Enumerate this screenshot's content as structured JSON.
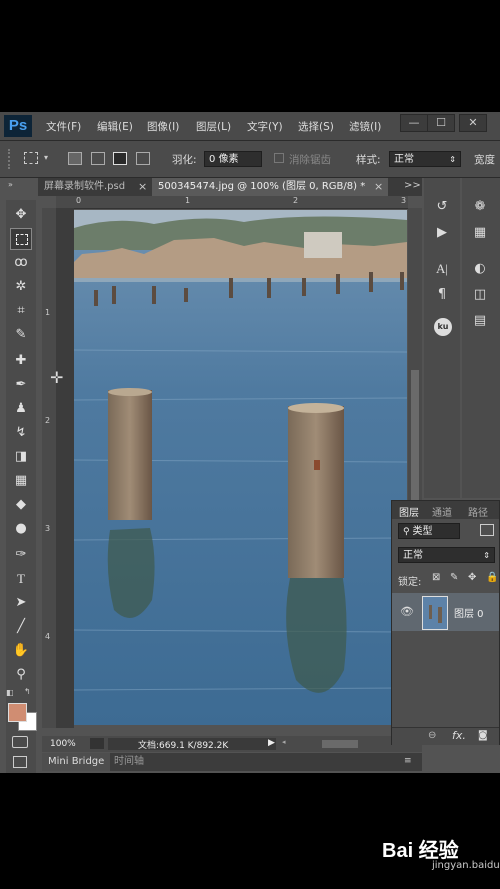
{
  "app": {
    "logo": "Ps",
    "menu": [
      "文件(F)",
      "编辑(E)",
      "图像(I)",
      "图层(L)",
      "文字(Y)",
      "选择(S)",
      "滤镜(I)"
    ],
    "window_buttons": [
      "—",
      "☐",
      "✕"
    ]
  },
  "options": {
    "feather_label": "羽化:",
    "feather_value": "0 像素",
    "antialias_label": "消除锯齿",
    "style_label": "样式:",
    "style_value": "正常",
    "width_label": "宽度"
  },
  "tabs": [
    {
      "label": "屏幕录制软件.psd",
      "close": "×"
    },
    {
      "label": "500345474.jpg @ 100% (图层 0, RGB/8) *",
      "close": "×"
    }
  ],
  "tabs_overflow": ">>",
  "rulers": {
    "top": [
      "0",
      "1",
      "2",
      "3"
    ],
    "left": [
      "1",
      "2",
      "3",
      "4"
    ]
  },
  "status": {
    "zoom": "100%",
    "doc": "文档:669.1 K/892.2K"
  },
  "bottom_tabs": [
    "Mini Bridge",
    "时间轴"
  ],
  "layers_panel": {
    "tabs": [
      "图层",
      "通道",
      "路径"
    ],
    "filter_label": "类型",
    "blend_mode": "正常",
    "lock_label": "锁定:",
    "layer_name": "图层 0",
    "footer_icons": [
      "link-icon",
      "fx-icon",
      "mask-icon"
    ],
    "fx_text": "fx."
  },
  "watermark": {
    "brand": "Bai 经验",
    "url": "jingyan.baidu.com"
  },
  "colors": {
    "foreground": "#d08d72",
    "background": "#ffffff",
    "ps_blue": "#49a0f0"
  }
}
